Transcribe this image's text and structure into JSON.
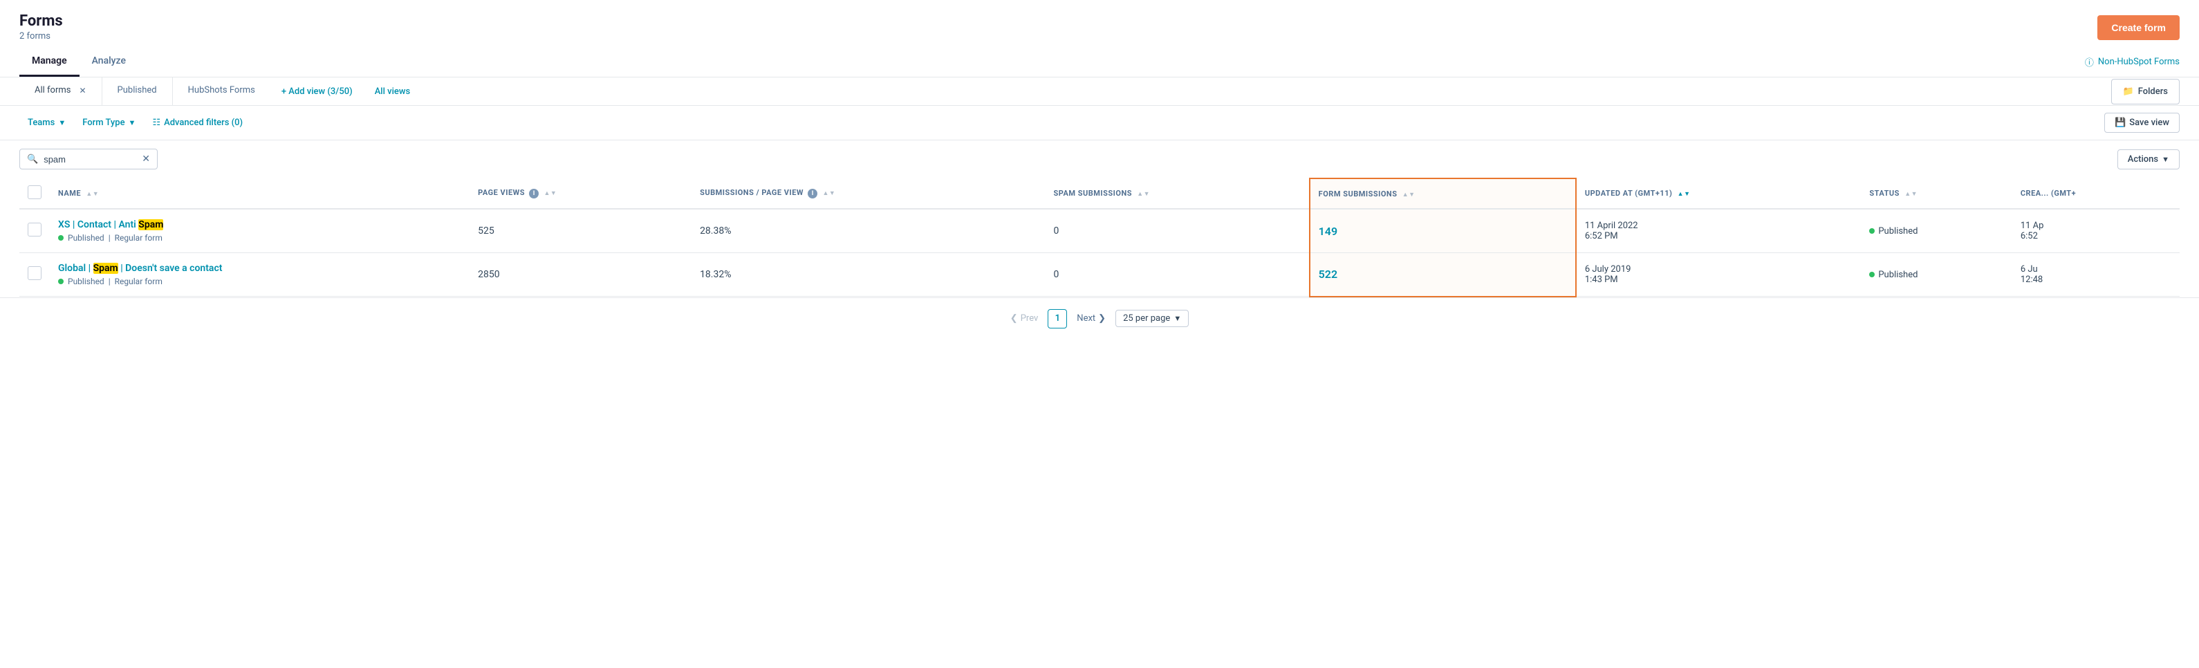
{
  "page": {
    "title": "Forms",
    "subtitle": "2 forms",
    "create_btn": "Create form",
    "non_hubspot_link": "Non-HubSpot Forms"
  },
  "tabs": [
    {
      "label": "Manage",
      "active": true
    },
    {
      "label": "Analyze",
      "active": false
    }
  ],
  "view_tabs": [
    {
      "label": "All forms",
      "closeable": true,
      "active": true
    },
    {
      "label": "Published",
      "closeable": false,
      "active": false
    },
    {
      "label": "HubShots Forms",
      "closeable": false,
      "active": false
    }
  ],
  "add_view_btn": "+ Add view (3/50)",
  "all_views_btn": "All views",
  "folders_btn": "Folders",
  "filters": [
    {
      "label": "Teams",
      "has_dropdown": true
    },
    {
      "label": "Form Type",
      "has_dropdown": true
    },
    {
      "label": "Advanced filters (0)",
      "has_icon": true
    }
  ],
  "save_view_btn": "Save view",
  "search": {
    "value": "spam",
    "placeholder": "Search"
  },
  "actions_btn": "Actions",
  "table": {
    "columns": [
      {
        "label": "NAME",
        "sortable": true,
        "info": false
      },
      {
        "label": "PAGE VIEWS",
        "sortable": true,
        "info": true
      },
      {
        "label": "SUBMISSIONS / PAGE VIEW",
        "sortable": true,
        "info": true
      },
      {
        "label": "SPAM SUBMISSIONS",
        "sortable": true,
        "info": false
      },
      {
        "label": "FORM SUBMISSIONS",
        "sortable": true,
        "info": false,
        "highlighted": true
      },
      {
        "label": "UPDATED AT (GMT+11)",
        "sortable": true,
        "info": false
      },
      {
        "label": "STATUS",
        "sortable": true,
        "info": false
      },
      {
        "label": "CREA... (GMT+",
        "sortable": false,
        "info": false
      }
    ],
    "rows": [
      {
        "name": "XS | Contact | Anti Spam",
        "name_highlight": "Spam",
        "highlight_start": 21,
        "status_dot": "published",
        "status_label": "Published",
        "form_type": "Regular form",
        "page_views": "525",
        "submissions_per_page": "28.38%",
        "spam_submissions": "0",
        "form_submissions": "149",
        "updated_at": "11 April 2022\n6:52 PM",
        "status": "Published",
        "created": "11 Ap\n6:52"
      },
      {
        "name": "Global | Spam | Doesn't save a contact",
        "name_highlight": "Spam",
        "highlight_start": 8,
        "status_dot": "published",
        "status_label": "Published",
        "form_type": "Regular form",
        "page_views": "2850",
        "submissions_per_page": "18.32%",
        "spam_submissions": "0",
        "form_submissions": "522",
        "updated_at": "6 July 2019\n1:43 PM",
        "status": "Published",
        "created": "6 Ju\n12:48"
      }
    ]
  },
  "pagination": {
    "prev_label": "Prev",
    "next_label": "Next",
    "current_page": "1",
    "per_page": "25 per page"
  }
}
